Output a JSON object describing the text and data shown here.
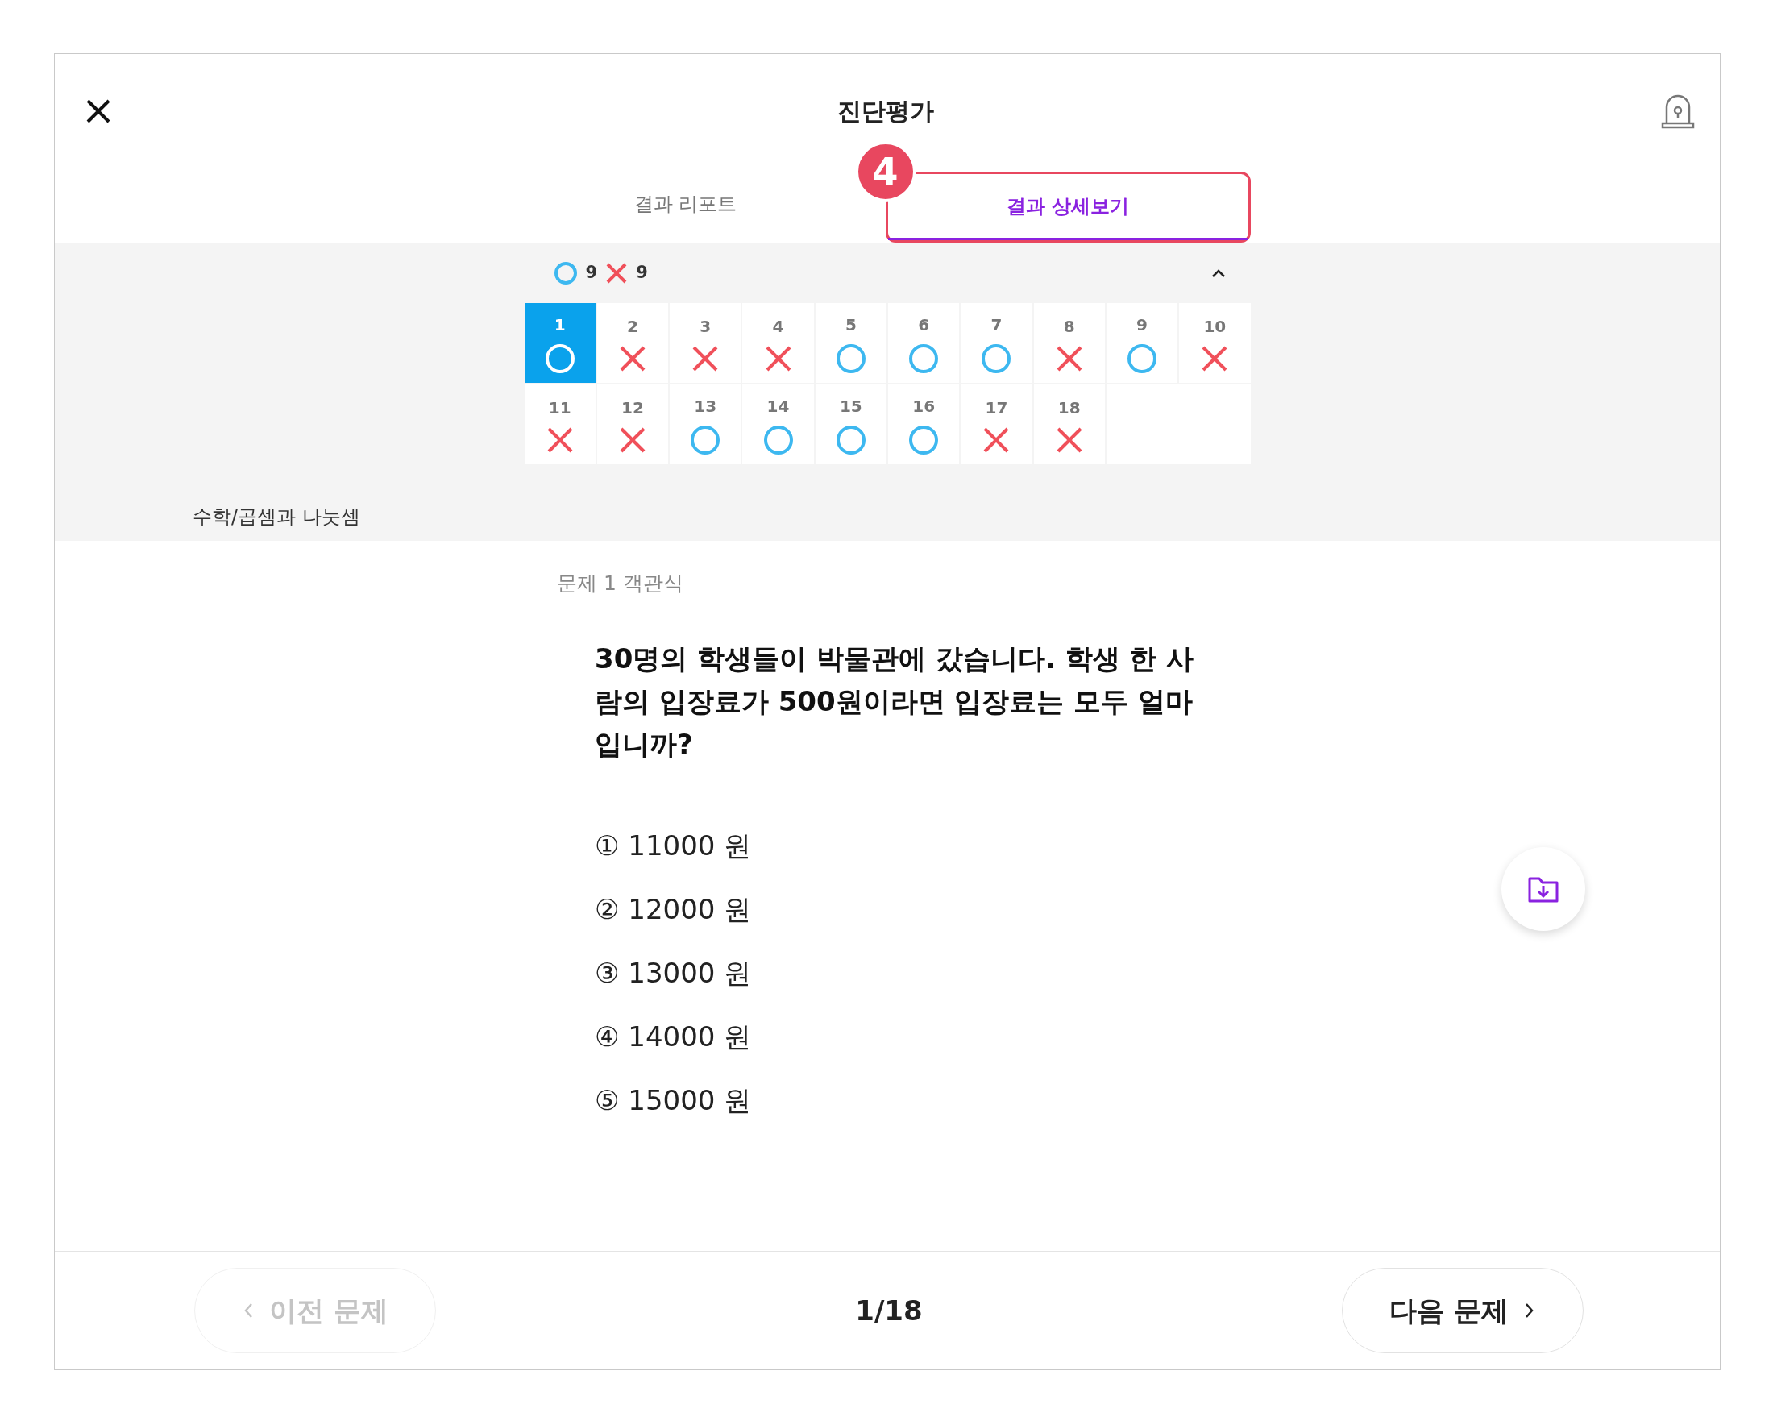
{
  "header": {
    "title": "진단평가"
  },
  "tabs": [
    {
      "label": "결과 리포트",
      "selected": false
    },
    {
      "label": "결과 상세보기",
      "selected": true
    }
  ],
  "callout": {
    "number": "4"
  },
  "summary": {
    "correct_count": "9",
    "wrong_count": "9",
    "expanded": true
  },
  "questions": [
    {
      "number": "1",
      "kind": "circle",
      "selected": true
    },
    {
      "number": "2",
      "kind": "cross",
      "selected": false
    },
    {
      "number": "3",
      "kind": "cross",
      "selected": false
    },
    {
      "number": "4",
      "kind": "cross",
      "selected": false
    },
    {
      "number": "5",
      "kind": "circle",
      "selected": false
    },
    {
      "number": "6",
      "kind": "circle",
      "selected": false
    },
    {
      "number": "7",
      "kind": "circle",
      "selected": false
    },
    {
      "number": "8",
      "kind": "cross",
      "selected": false
    },
    {
      "number": "9",
      "kind": "circle",
      "selected": false
    },
    {
      "number": "10",
      "kind": "cross",
      "selected": false
    },
    {
      "number": "11",
      "kind": "cross",
      "selected": false
    },
    {
      "number": "12",
      "kind": "cross",
      "selected": false
    },
    {
      "number": "13",
      "kind": "circle",
      "selected": false
    },
    {
      "number": "14",
      "kind": "circle",
      "selected": false
    },
    {
      "number": "15",
      "kind": "circle",
      "selected": false
    },
    {
      "number": "16",
      "kind": "circle",
      "selected": false
    },
    {
      "number": "17",
      "kind": "cross",
      "selected": false
    },
    {
      "number": "18",
      "kind": "cross",
      "selected": false
    }
  ],
  "category": "수학/곱셈과 나눗셈",
  "question": {
    "label": "문제 1 객관식",
    "text": "30명의 학생들이 박물관에 갔습니다. 학생 한 사람의 입장료가 500원이라면 입장료는 모두 얼마입니까?",
    "choices": [
      "① 11000 원",
      "② 12000 원",
      "③ 13000 원",
      "④ 14000 원",
      "⑤ 15000 원"
    ]
  },
  "footer": {
    "prev": {
      "label": "이전 문제",
      "disabled": true
    },
    "page": "1/18",
    "next": {
      "label": "다음 문제",
      "disabled": false
    }
  }
}
